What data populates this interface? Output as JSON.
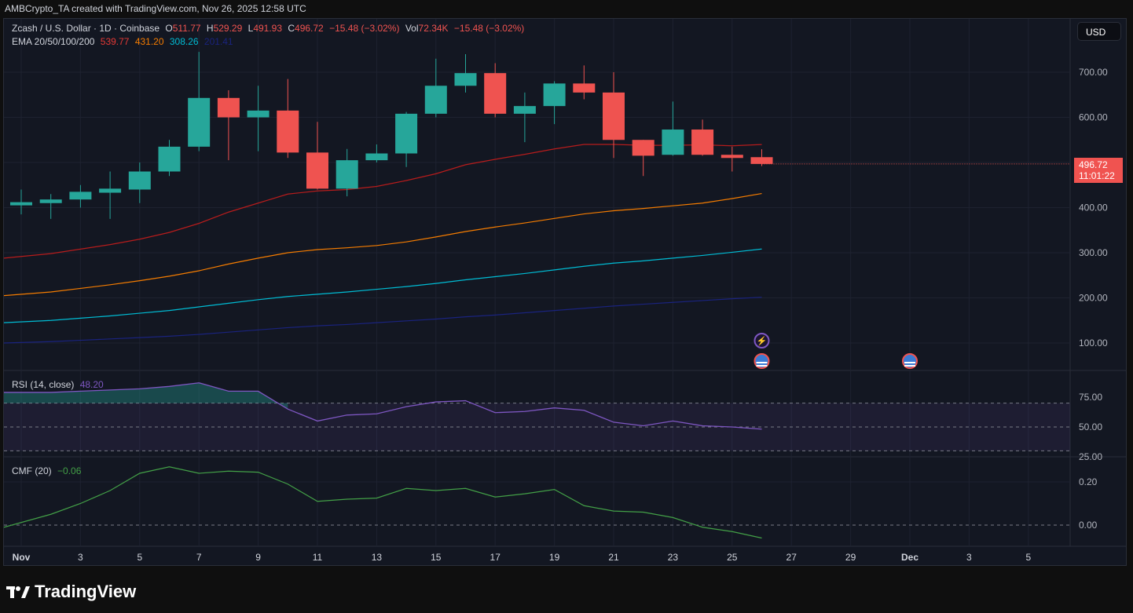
{
  "credit": "AMBCrypto_TA created with TradingView.com, Nov 26, 2025 12:58 UTC",
  "legend": {
    "symbol": "Zcash / U.S. Dollar · 1D · Coinbase",
    "o_label": "O",
    "o": "511.77",
    "h_label": "H",
    "h": "529.29",
    "l_label": "L",
    "l": "491.93",
    "c_label": "C",
    "c": "496.72",
    "change": "−15.48 (−3.02%)",
    "vol_label": "Vol",
    "vol": "72.34K",
    "vol_change": "−15.48 (−3.02%)",
    "ema_label": "EMA 20/50/100/200",
    "ema20": "539.77",
    "ema50": "431.20",
    "ema100": "308.26",
    "ema200": "201.41"
  },
  "currency": "USD",
  "price_tag": {
    "price": "496.72",
    "countdown": "11:01:22"
  },
  "rsi": {
    "label": "RSI (14, close)",
    "value": "48.20"
  },
  "cmf": {
    "label": "CMF (20)",
    "value": "−0.06"
  },
  "logo": "TradingView",
  "colors": {
    "up": "#26a69a",
    "down": "#ef5350",
    "ema20": "#b71c1c",
    "ema50": "#f57c00",
    "ema100": "#00bcd4",
    "ema200": "#1a237e",
    "rsi": "#7e57c2",
    "cmf": "#43a047"
  },
  "chart_data": [
    {
      "type": "candlestick",
      "title": "Zcash / U.S. Dollar · 1D · Coinbase",
      "x": [
        "Nov 1",
        "Nov 2",
        "Nov 3",
        "Nov 4",
        "Nov 5",
        "Nov 6",
        "Nov 7",
        "Nov 8",
        "Nov 9",
        "Nov 10",
        "Nov 11",
        "Nov 12",
        "Nov 13",
        "Nov 14",
        "Nov 15",
        "Nov 16",
        "Nov 17",
        "Nov 18",
        "Nov 19",
        "Nov 20",
        "Nov 21",
        "Nov 22",
        "Nov 23",
        "Nov 24",
        "Nov 25",
        "Nov 26"
      ],
      "ohlc": [
        [
          405,
          440,
          385,
          412
        ],
        [
          410,
          430,
          375,
          418
        ],
        [
          418,
          450,
          400,
          435
        ],
        [
          433,
          480,
          375,
          442
        ],
        [
          440,
          500,
          410,
          480
        ],
        [
          480,
          550,
          470,
          535
        ],
        [
          535,
          745,
          525,
          643
        ],
        [
          643,
          660,
          505,
          600
        ],
        [
          600,
          670,
          525,
          615
        ],
        [
          615,
          685,
          510,
          522
        ],
        [
          522,
          590,
          440,
          442
        ],
        [
          442,
          530,
          425,
          505
        ],
        [
          505,
          540,
          500,
          520
        ],
        [
          520,
          612,
          490,
          608
        ],
        [
          608,
          730,
          600,
          670
        ],
        [
          670,
          740,
          655,
          698
        ],
        [
          698,
          720,
          600,
          608
        ],
        [
          608,
          655,
          545,
          625
        ],
        [
          625,
          680,
          585,
          675
        ],
        [
          675,
          715,
          640,
          655
        ],
        [
          655,
          700,
          510,
          550
        ],
        [
          550,
          550,
          470,
          515
        ],
        [
          517,
          635,
          515,
          573
        ],
        [
          573,
          595,
          515,
          517
        ],
        [
          517,
          535,
          480,
          510
        ],
        [
          511.77,
          529.29,
          491.93,
          496.72
        ]
      ],
      "series": [
        {
          "name": "EMA 20",
          "values": [
            288,
            298,
            308,
            318,
            330,
            345,
            365,
            390,
            410,
            430,
            437,
            440,
            447,
            460,
            475,
            495,
            507,
            518,
            530,
            540,
            540,
            538,
            538,
            539,
            537,
            539.77
          ]
        },
        {
          "name": "EMA 50",
          "values": [
            205,
            213,
            221,
            229,
            238,
            248,
            260,
            275,
            288,
            300,
            307,
            311,
            316,
            324,
            335,
            347,
            357,
            366,
            376,
            386,
            393,
            398,
            404,
            410,
            420,
            431.2
          ]
        },
        {
          "name": "EMA 100",
          "values": [
            145,
            150,
            155,
            160,
            166,
            172,
            180,
            188,
            196,
            203,
            208,
            213,
            219,
            225,
            232,
            240,
            247,
            254,
            262,
            270,
            277,
            282,
            288,
            294,
            301,
            308.26
          ]
        },
        {
          "name": "EMA 200",
          "values": [
            100,
            103,
            106,
            109,
            112,
            115,
            119,
            124,
            129,
            134,
            138,
            141,
            145,
            149,
            153,
            158,
            162,
            167,
            172,
            177,
            182,
            186,
            190,
            194,
            198,
            201.41
          ]
        }
      ],
      "yticks": [
        "100.00",
        "200.00",
        "300.00",
        "400.00",
        "500.00",
        "600.00",
        "700.00"
      ],
      "ylim": [
        0,
        780
      ]
    },
    {
      "type": "line",
      "title": "RSI (14, close)",
      "series": [
        {
          "name": "RSI",
          "values": [
            79,
            79,
            80,
            81,
            82,
            84,
            87,
            80,
            80,
            65,
            55,
            60,
            61,
            67,
            71,
            72,
            62,
            63,
            66,
            64,
            54,
            51,
            55,
            51,
            50,
            48.2
          ]
        }
      ],
      "bands": [
        30,
        50,
        70
      ],
      "yticks": [
        "25.00",
        "50.00",
        "75.00"
      ]
    },
    {
      "type": "line",
      "title": "CMF (20)",
      "series": [
        {
          "name": "CMF",
          "values": [
            -0.01,
            0.05,
            0.1,
            0.16,
            0.24,
            0.27,
            0.24,
            0.25,
            0.245,
            0.19,
            0.11,
            0.12,
            0.125,
            0.17,
            0.16,
            0.17,
            0.13,
            0.145,
            0.165,
            0.09,
            0.065,
            0.06,
            0.035,
            -0.01,
            -0.03,
            -0.06
          ]
        }
      ],
      "yticks": [
        "0.00",
        "0.20"
      ]
    }
  ],
  "xticks": [
    "Nov",
    "3",
    "5",
    "7",
    "9",
    "11",
    "13",
    "15",
    "17",
    "19",
    "21",
    "23",
    "25",
    "27",
    "29",
    "Dec",
    "3",
    "5"
  ]
}
